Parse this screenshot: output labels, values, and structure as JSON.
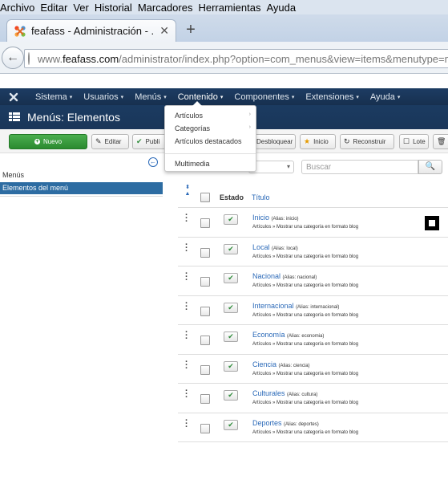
{
  "browser": {
    "menubar": [
      "Archivo",
      "Editar",
      "Ver",
      "Historial",
      "Marcadores",
      "Herramientas",
      "Ayuda"
    ],
    "tab_title": "feafass - Administración - ...",
    "url_www": "www.",
    "url_host": "feafass.com",
    "url_path": "/administrator/index.php?option=com_menus&view=items&menutype=ma"
  },
  "admin_nav": {
    "items": [
      "Sistema",
      "Usuarios",
      "Menús",
      "Contenido",
      "Componentes",
      "Extensiones",
      "Ayuda"
    ]
  },
  "page": {
    "title": "Menús: Elementos"
  },
  "toolbar": {
    "new": "Nuevo",
    "edit": "Editar",
    "publish": "Publi",
    "unlock": "Desbloquear",
    "home": "Inicio",
    "rebuild": "Reconstruir",
    "batch": "Lote"
  },
  "sidebar": {
    "heading": "Menús",
    "active_item": "Elementos del menú"
  },
  "filters": {
    "search_placeholder": "Buscar"
  },
  "table": {
    "col_status": "Estado",
    "col_title": "Título",
    "rows": [
      {
        "title": "Inicio",
        "alias": "(Alias: inicio)",
        "type": "Artículos » Mostrar una categoría en formato blog"
      },
      {
        "title": "Local",
        "alias": "(Alias: local)",
        "type": "Artículos » Mostrar una categoría en formato blog"
      },
      {
        "title": "Nacional",
        "alias": "(Alias: nacional)",
        "type": "Artículos » Mostrar una categoría en formato blog"
      },
      {
        "title": "Internacional",
        "alias": "(Alias: internacional)",
        "type": "Artículos » Mostrar una categoría en formato blog"
      },
      {
        "title": "Economía",
        "alias": "(Alias: economia)",
        "type": "Artículos » Mostrar una categoría en formato blog"
      },
      {
        "title": "Ciencia",
        "alias": "(Alias: ciencia)",
        "type": "Artículos » Mostrar una categoría en formato blog"
      },
      {
        "title": "Culturales",
        "alias": "(Alias: cultura)",
        "type": "Artículos » Mostrar una categoría en formato blog"
      },
      {
        "title": "Deportes",
        "alias": "(Alias: deportes)",
        "type": "Artículos » Mostrar una categoría en formato blog"
      }
    ]
  },
  "dropdown": {
    "items": [
      "Artículos",
      "Categorías",
      "Artículos destacados",
      "Multimedia"
    ]
  },
  "colors": {
    "joomla_navy": "#1b3b61",
    "link_blue": "#2a69b8",
    "new_green": "#2b8b30",
    "active_sidebar": "#2d6ca2"
  }
}
